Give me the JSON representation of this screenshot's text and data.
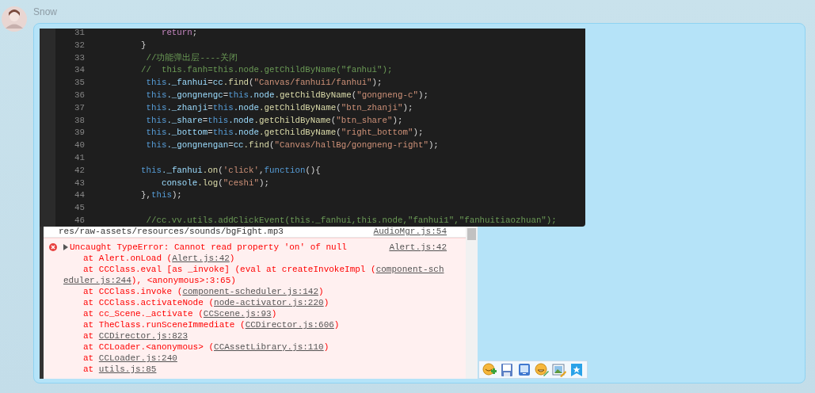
{
  "sender": {
    "name": "Snow"
  },
  "message": {
    "code_screenshot": {
      "lines": [
        {
          "number": "31",
          "kind": "inner",
          "tokens": [
            {
              "kind": "ret",
              "text": "return"
            },
            {
              "kind": "p",
              "text": ";"
            }
          ]
        },
        {
          "number": "32",
          "kind": "outer",
          "tokens": [
            {
              "kind": "p",
              "text": "}"
            }
          ]
        },
        {
          "number": "33",
          "kind": "mid",
          "tokens": [
            {
              "kind": "cm",
              "text": "//功能弹出层----关闭"
            }
          ]
        },
        {
          "number": "34",
          "kind": "outer",
          "tokens": [
            {
              "kind": "cm",
              "text": "//  this.fanh=this.node.getChildByName(\"fanhui\");"
            }
          ]
        },
        {
          "number": "35",
          "kind": "mid",
          "tokens": [
            {
              "kind": "kw",
              "text": "this"
            },
            {
              "kind": "prop",
              "text": "._fanhui"
            },
            {
              "kind": "p",
              "text": "="
            },
            {
              "kind": "prop",
              "text": "cc"
            },
            {
              "kind": "fn",
              "text": ".find"
            },
            {
              "kind": "p",
              "text": "("
            },
            {
              "kind": "str",
              "text": "\"Canvas/fanhui1/fanhui\""
            },
            {
              "kind": "p",
              "text": ");"
            }
          ]
        },
        {
          "number": "36",
          "kind": "mid",
          "tokens": [
            {
              "kind": "kw",
              "text": "this"
            },
            {
              "kind": "prop",
              "text": "._gongnengc"
            },
            {
              "kind": "p",
              "text": "="
            },
            {
              "kind": "kw",
              "text": "this"
            },
            {
              "kind": "prop",
              "text": ".node"
            },
            {
              "kind": "fn",
              "text": ".getChildByName"
            },
            {
              "kind": "p",
              "text": "("
            },
            {
              "kind": "str",
              "text": "\"gongneng-c\""
            },
            {
              "kind": "p",
              "text": ");"
            }
          ]
        },
        {
          "number": "37",
          "kind": "mid",
          "tokens": [
            {
              "kind": "kw",
              "text": "this"
            },
            {
              "kind": "prop",
              "text": "._zhanji"
            },
            {
              "kind": "p",
              "text": "="
            },
            {
              "kind": "kw",
              "text": "this"
            },
            {
              "kind": "prop",
              "text": ".node"
            },
            {
              "kind": "fn",
              "text": ".getChildByName"
            },
            {
              "kind": "p",
              "text": "("
            },
            {
              "kind": "str",
              "text": "\"btn_zhanji\""
            },
            {
              "kind": "p",
              "text": ");"
            }
          ]
        },
        {
          "number": "38",
          "kind": "mid",
          "tokens": [
            {
              "kind": "kw",
              "text": "this"
            },
            {
              "kind": "prop",
              "text": "._share"
            },
            {
              "kind": "p",
              "text": "="
            },
            {
              "kind": "kw",
              "text": "this"
            },
            {
              "kind": "prop",
              "text": ".node"
            },
            {
              "kind": "fn",
              "text": ".getChildByName"
            },
            {
              "kind": "p",
              "text": "("
            },
            {
              "kind": "str",
              "text": "\"btn_share\""
            },
            {
              "kind": "p",
              "text": ");"
            }
          ]
        },
        {
          "number": "39",
          "kind": "mid",
          "tokens": [
            {
              "kind": "kw",
              "text": "this"
            },
            {
              "kind": "prop",
              "text": "._bottom"
            },
            {
              "kind": "p",
              "text": "="
            },
            {
              "kind": "kw",
              "text": "this"
            },
            {
              "kind": "prop",
              "text": ".node"
            },
            {
              "kind": "fn",
              "text": ".getChildByName"
            },
            {
              "kind": "p",
              "text": "("
            },
            {
              "kind": "str",
              "text": "\"right_bottom\""
            },
            {
              "kind": "p",
              "text": ");"
            }
          ]
        },
        {
          "number": "40",
          "kind": "mid",
          "tokens": [
            {
              "kind": "kw",
              "text": "this"
            },
            {
              "kind": "prop",
              "text": "._gongnengan"
            },
            {
              "kind": "p",
              "text": "="
            },
            {
              "kind": "prop",
              "text": "cc"
            },
            {
              "kind": "fn",
              "text": ".find"
            },
            {
              "kind": "p",
              "text": "("
            },
            {
              "kind": "str",
              "text": "\"Canvas/hallBg/gongneng-right\""
            },
            {
              "kind": "p",
              "text": ");"
            }
          ]
        },
        {
          "number": "41"
        },
        {
          "number": "42",
          "kind": "outer",
          "tokens": [
            {
              "kind": "kw",
              "text": "this"
            },
            {
              "kind": "prop",
              "text": "._fanhui"
            },
            {
              "kind": "fn",
              "text": ".on"
            },
            {
              "kind": "p",
              "text": "("
            },
            {
              "kind": "str",
              "text": "'click'"
            },
            {
              "kind": "p",
              "text": ","
            },
            {
              "kind": "kw",
              "text": "function"
            },
            {
              "kind": "p",
              "text": "(){"
            }
          ]
        },
        {
          "number": "43",
          "kind": "inner",
          "tokens": [
            {
              "kind": "prop",
              "text": "console"
            },
            {
              "kind": "fn",
              "text": ".log"
            },
            {
              "kind": "p",
              "text": "("
            },
            {
              "kind": "str",
              "text": "\"ceshi\""
            },
            {
              "kind": "p",
              "text": ");"
            }
          ]
        },
        {
          "number": "44",
          "kind": "outer",
          "tokens": [
            {
              "kind": "p",
              "text": "},"
            },
            {
              "kind": "kw",
              "text": "this"
            },
            {
              "kind": "p",
              "text": ");"
            }
          ]
        },
        {
          "number": "45"
        },
        {
          "number": "46",
          "kind": "mid",
          "tokens": [
            {
              "kind": "cm",
              "text": "//cc.vv.utils.addClickEvent(this._fanhui,this.node,\"fanhui1\",\"fanhuitiaozhuan\");"
            }
          ]
        }
      ]
    },
    "console_screenshot": {
      "rows": [
        {
          "kind": "log",
          "text": "res/raw-assets/resources/sounds/bgFight.mp3",
          "source": "AudioMgr.js:54"
        },
        {
          "kind": "error",
          "text": "Uncaught TypeError: Cannot read property 'on' of null",
          "source": "Alert.js:42",
          "stack": [
            {
              "kind": "frame",
              "segments": [
                {
                  "kind": "text",
                  "text": "at Alert.onLoad ("
                },
                {
                  "kind": "link",
                  "text": "Alert.js:42"
                },
                {
                  "kind": "text",
                  "text": ")"
                }
              ]
            },
            {
              "kind": "frame",
              "segments": [
                {
                  "kind": "text",
                  "text": "at CCClass.eval [as _invoke] (eval at createInvokeImpl ("
                },
                {
                  "kind": "link",
                  "text": "component-sch"
                }
              ]
            },
            {
              "kind": "wrap",
              "segments": [
                {
                  "kind": "link",
                  "text": "eduler.js:244"
                },
                {
                  "kind": "text",
                  "text": "), <anonymous>:3:65)"
                }
              ]
            },
            {
              "kind": "frame",
              "segments": [
                {
                  "kind": "text",
                  "text": "at CCClass.invoke ("
                },
                {
                  "kind": "link",
                  "text": "component-scheduler.js:142"
                },
                {
                  "kind": "text",
                  "text": ")"
                }
              ]
            },
            {
              "kind": "frame",
              "segments": [
                {
                  "kind": "text",
                  "text": "at CCClass.activateNode ("
                },
                {
                  "kind": "link",
                  "text": "node-activator.js:220"
                },
                {
                  "kind": "text",
                  "text": ")"
                }
              ]
            },
            {
              "kind": "frame",
              "segments": [
                {
                  "kind": "text",
                  "text": "at cc_Scene._activate ("
                },
                {
                  "kind": "link",
                  "text": "CCScene.js:93"
                },
                {
                  "kind": "text",
                  "text": ")"
                }
              ]
            },
            {
              "kind": "frame",
              "segments": [
                {
                  "kind": "text",
                  "text": "at TheClass.runSceneImmediate ("
                },
                {
                  "kind": "link",
                  "text": "CCDirector.js:606"
                },
                {
                  "kind": "text",
                  "text": ")"
                }
              ]
            },
            {
              "kind": "frame",
              "segments": [
                {
                  "kind": "text",
                  "text": "at "
                },
                {
                  "kind": "link",
                  "text": "CCDirector.js:823"
                }
              ]
            },
            {
              "kind": "frame",
              "segments": [
                {
                  "kind": "text",
                  "text": "at CCLoader.<anonymous> ("
                },
                {
                  "kind": "link",
                  "text": "CCAssetLibrary.js:110"
                },
                {
                  "kind": "text",
                  "text": ")"
                }
              ]
            },
            {
              "kind": "frame",
              "segments": [
                {
                  "kind": "text",
                  "text": "at "
                },
                {
                  "kind": "link",
                  "text": "CCLoader.js:240"
                }
              ]
            },
            {
              "kind": "frame",
              "segments": [
                {
                  "kind": "text",
                  "text": "at "
                },
                {
                  "kind": "link",
                  "text": "utils.js:85"
                }
              ]
            }
          ]
        }
      ]
    }
  }
}
